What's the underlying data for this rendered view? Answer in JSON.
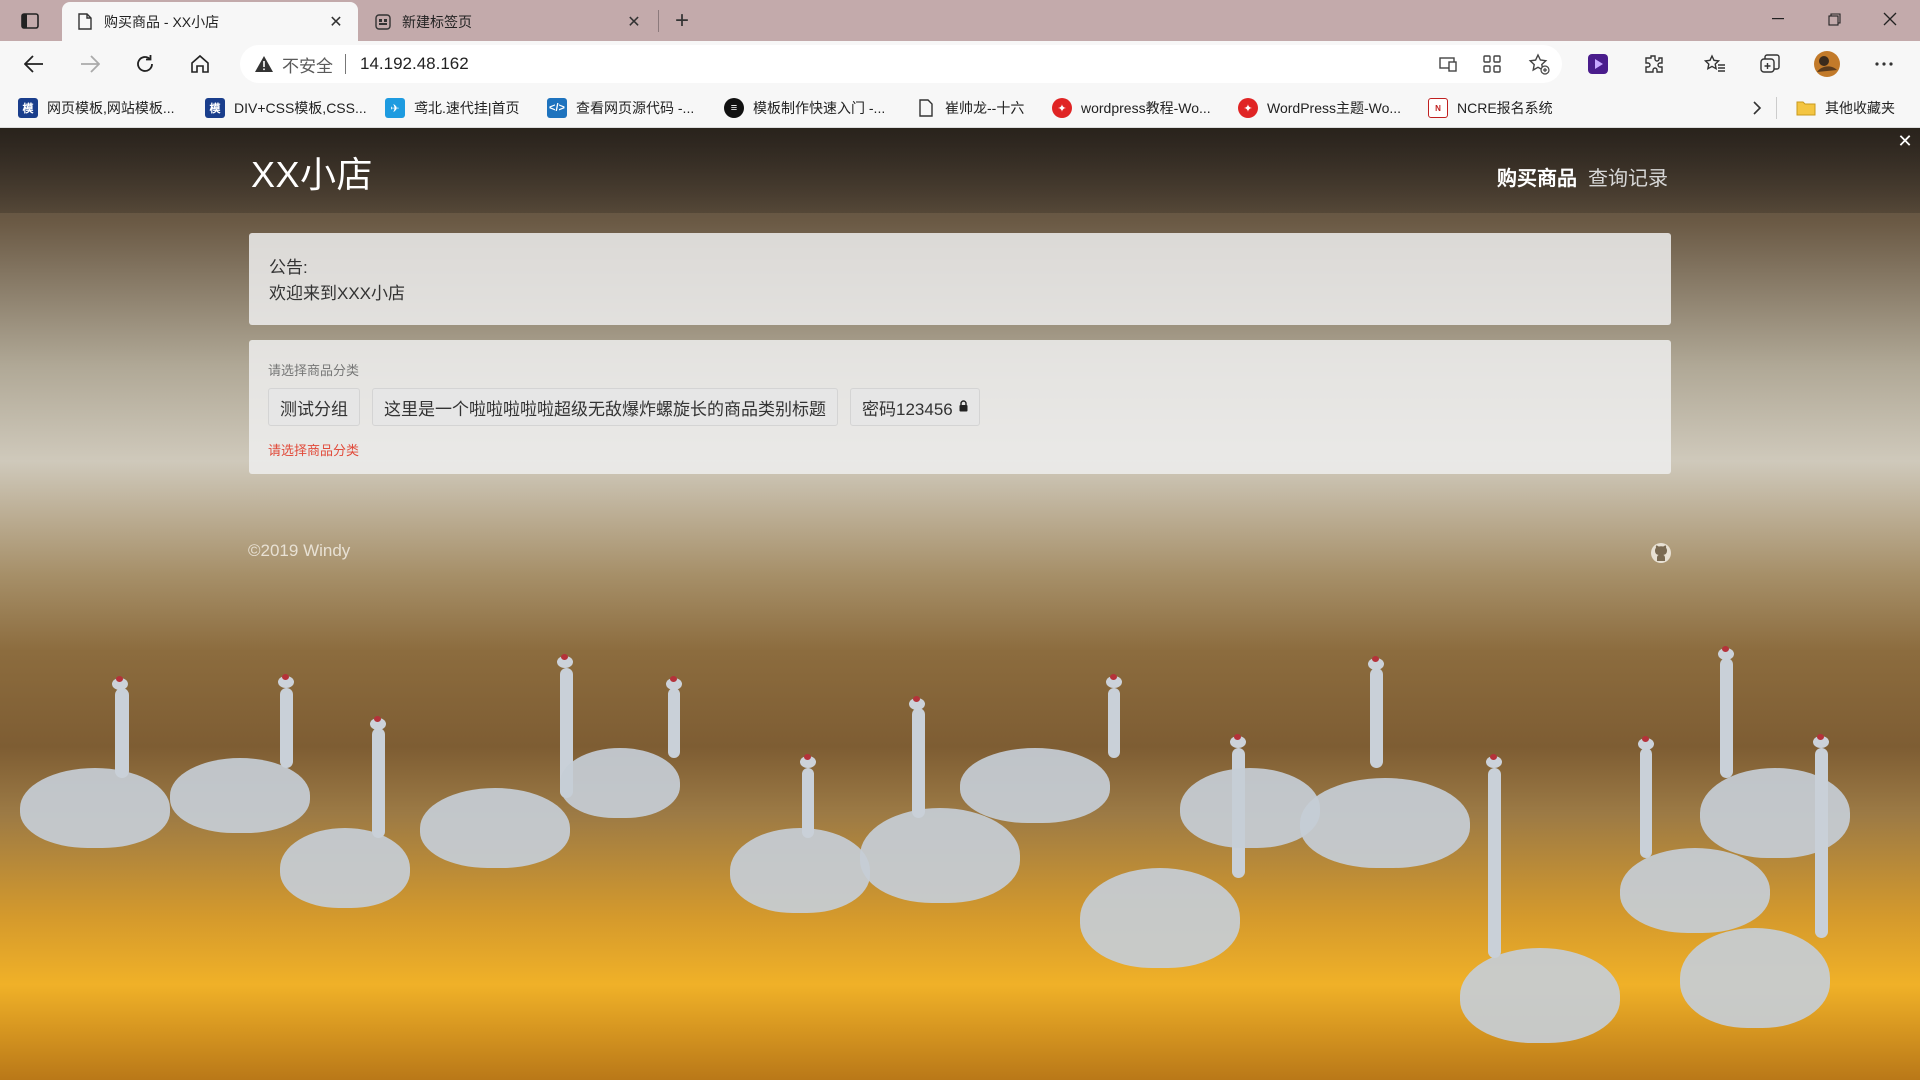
{
  "browser": {
    "tabs": [
      {
        "title": "购买商品 - XX小店",
        "active": true,
        "icon": "page-icon"
      },
      {
        "title": "新建标签页",
        "active": false,
        "icon": "new-tab-page-icon"
      }
    ],
    "address": {
      "security_label": "不安全",
      "url": "14.192.48.162"
    },
    "bookmarks": [
      {
        "label": "网页模板,网站模板...",
        "icon": "mo-icon",
        "color": "#1a3e8c"
      },
      {
        "label": "DIV+CSS模板,CSS...",
        "icon": "mo-icon",
        "color": "#1a3e8c"
      },
      {
        "label": "鸢北.速代挂|首页",
        "icon": "bird-icon",
        "color": "#1e9be0"
      },
      {
        "label": "查看网页源代码 -...",
        "icon": "code-icon",
        "color": "#1e73be"
      },
      {
        "label": "模板制作快速入门 -...",
        "icon": "list-icon",
        "color": "#111111"
      },
      {
        "label": "崔帅龙--十六",
        "icon": "document-icon",
        "color": "#444444"
      },
      {
        "label": "wordpress教程-Wo...",
        "icon": "wp-red-icon",
        "color": "#e02424"
      },
      {
        "label": "WordPress主题-Wo...",
        "icon": "wp-red-icon",
        "color": "#e02424"
      },
      {
        "label": "NCRE报名系统",
        "icon": "ncre-icon",
        "color": "#c02020"
      }
    ],
    "other_favorites": "其他收藏夹"
  },
  "site": {
    "title": "XX小店",
    "nav": {
      "buy": "购买商品",
      "query": "查询记录"
    },
    "notice": {
      "label": "公告:",
      "text": "欢迎来到XXX小店"
    },
    "category": {
      "label": "请选择商品分类",
      "buttons": [
        {
          "label": "测试分组",
          "locked": false
        },
        {
          "label": "这里是一个啦啦啦啦啦超级无敌爆炸螺旋长的商品类别标题",
          "locked": false
        },
        {
          "label": "密码123456",
          "locked": true
        }
      ],
      "error": "请选择商品分类"
    },
    "footer": {
      "copyright": "©2019 Windy"
    }
  },
  "colors": {
    "error": "#e14b3b",
    "tabbar": "#c3aaab",
    "toolbar": "#f7f7f7"
  }
}
